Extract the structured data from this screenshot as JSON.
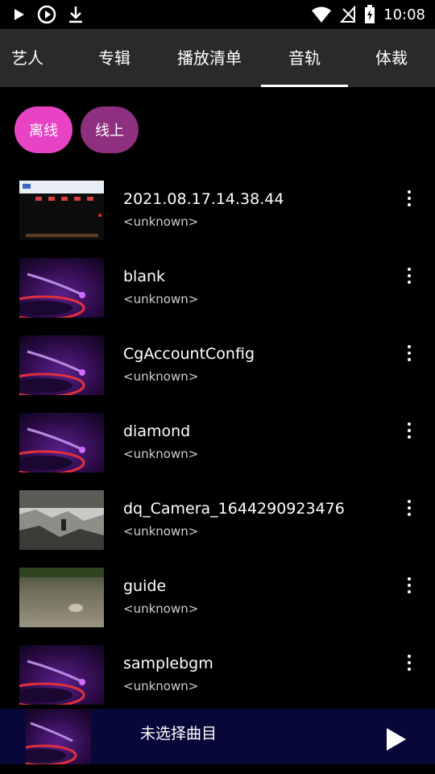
{
  "status_bar": {
    "time": "10:08"
  },
  "tabs": [
    {
      "label": "艺人"
    },
    {
      "label": "专辑"
    },
    {
      "label": "播放清单"
    },
    {
      "label": "音轨",
      "selected": true
    },
    {
      "label": "体裁"
    }
  ],
  "chips": [
    {
      "label": "离线",
      "active": true
    },
    {
      "label": "线上",
      "active": false
    }
  ],
  "tracks": [
    {
      "title": "2021.08.17.14.38.44",
      "subtitle": "<unknown>",
      "thumb": "screen-capture"
    },
    {
      "title": "blank",
      "subtitle": "<unknown>",
      "thumb": "turntable-purple"
    },
    {
      "title": "CgAccountConfig",
      "subtitle": "<unknown>",
      "thumb": "turntable-purple"
    },
    {
      "title": "diamond",
      "subtitle": "<unknown>",
      "thumb": "turntable-purple"
    },
    {
      "title": "dq_Camera_1644290923476",
      "subtitle": "<unknown>",
      "thumb": "outdoor-ground"
    },
    {
      "title": "guide",
      "subtitle": "<unknown>",
      "thumb": "grass-ground"
    },
    {
      "title": "samplebgm",
      "subtitle": "<unknown>",
      "thumb": "turntable-purple"
    }
  ],
  "player": {
    "title": "未选择曲目"
  },
  "colors": {
    "tab_bg": "#2a2a2a",
    "chip_active": "#e843c4",
    "chip_inactive": "#8f2f7f",
    "player_bg": "#07073a"
  }
}
